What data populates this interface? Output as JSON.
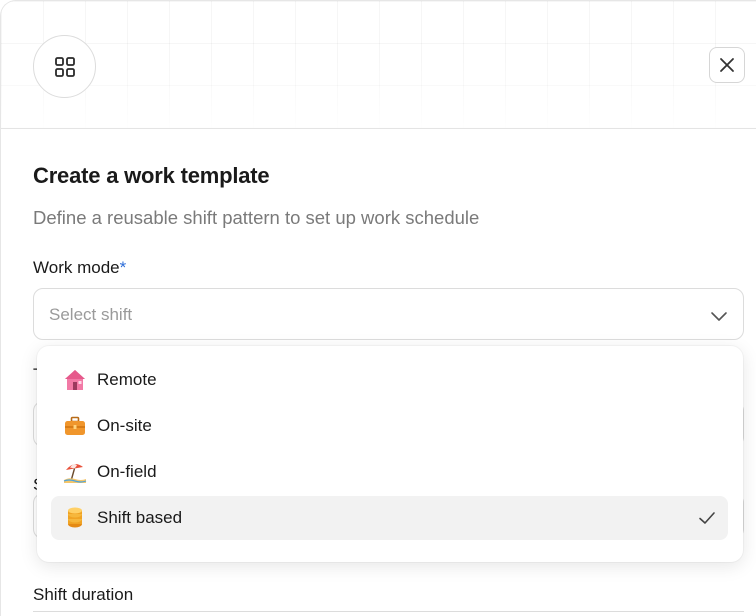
{
  "header": {
    "app_icon": "grid-icon",
    "close_icon": "close-icon"
  },
  "form": {
    "title": "Create a work template",
    "subtitle": "Define a reusable shift pattern to set up work schedule",
    "work_mode": {
      "label": "Work mode",
      "required_mark": "*",
      "placeholder": "Select shift",
      "options": [
        {
          "label": "Remote",
          "icon": "house-emoji",
          "selected": false
        },
        {
          "label": "On-site",
          "icon": "briefcase-emoji",
          "selected": false
        },
        {
          "label": "On-field",
          "icon": "beach-umbrella-emoji",
          "selected": false
        },
        {
          "label": "Shift based",
          "icon": "coin-stack-emoji",
          "selected": true
        }
      ]
    },
    "shift_duration": {
      "label": "Shift duration"
    }
  },
  "colors": {
    "required": "#2b6cd8",
    "selected_bg": "#f2f2f2",
    "border": "#dcdcdc"
  }
}
